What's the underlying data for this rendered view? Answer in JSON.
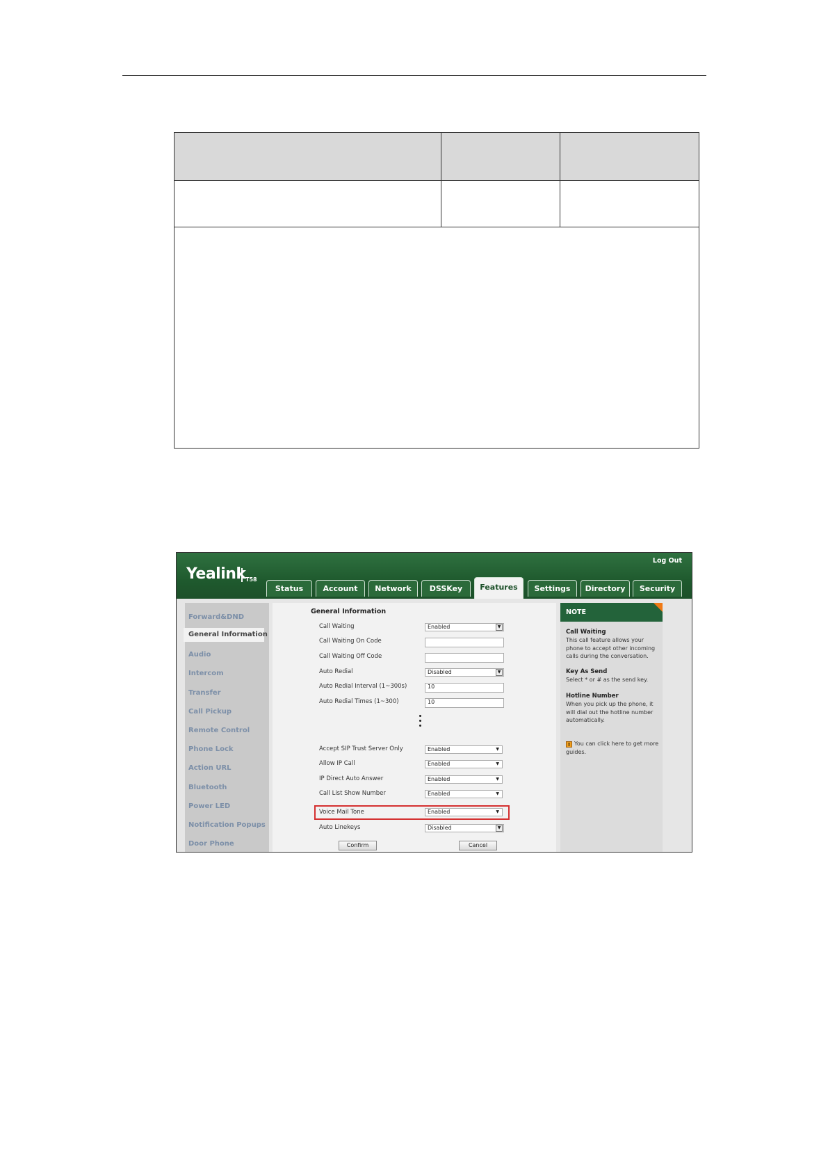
{
  "screenshot": {
    "header": {
      "logout": "Log Out",
      "brand": "Yealink",
      "model": "T58"
    },
    "tabs": [
      "Status",
      "Account",
      "Network",
      "DSSKey",
      "Features",
      "Settings",
      "Directory",
      "Security"
    ],
    "active_tab": "Features",
    "sidebar": [
      "Forward&DND",
      "General Information",
      "Audio",
      "Intercom",
      "Transfer",
      "Call Pickup",
      "Remote Control",
      "Phone Lock",
      "Action URL",
      "Bluetooth",
      "Power LED",
      "Notification Popups",
      "Door Phone"
    ],
    "active_sidebar": "General Information",
    "section_title": "General Information",
    "fields": [
      {
        "label": "Call Waiting",
        "value": "Enabled",
        "control": "select"
      },
      {
        "label": "Call Waiting On Code",
        "value": "",
        "control": "text"
      },
      {
        "label": "Call Waiting Off Code",
        "value": "",
        "control": "text"
      },
      {
        "label": "Auto Redial",
        "value": "Disabled",
        "control": "select"
      },
      {
        "label": "Auto Redial Interval (1~300s)",
        "value": "10",
        "control": "text"
      },
      {
        "label": "Auto Redial Times (1~300)",
        "value": "10",
        "control": "text"
      },
      {
        "label": "Accept SIP Trust Server Only",
        "value": "Enabled",
        "control": "dropdown"
      },
      {
        "label": "Allow IP Call",
        "value": "Enabled",
        "control": "dropdown"
      },
      {
        "label": "IP Direct Auto Answer",
        "value": "Enabled",
        "control": "dropdown"
      },
      {
        "label": "Call List Show Number",
        "value": "Enabled",
        "control": "dropdown"
      },
      {
        "label": "Voice Mail Tone",
        "value": "Enabled",
        "control": "dropdown"
      },
      {
        "label": "Auto Linekeys",
        "value": "Disabled",
        "control": "select"
      }
    ],
    "buttons": {
      "confirm": "Confirm",
      "cancel": "Cancel"
    },
    "note": {
      "heading": "NOTE",
      "items": [
        {
          "title": "Call Waiting",
          "text": "This call feature allows your phone to accept other incoming calls during the conversation."
        },
        {
          "title": "Key As Send",
          "text": "Select * or # as the send key."
        },
        {
          "title": "Hotline Number",
          "text": "When you pick up the phone, it will dial out the hotline number automatically."
        }
      ],
      "guide_icon": "!",
      "guide": "You can click here to get more guides."
    },
    "colors": {
      "header_green": "#1f5a2e",
      "highlight_red": "#d43030",
      "note_corner": "#f07a16"
    }
  }
}
